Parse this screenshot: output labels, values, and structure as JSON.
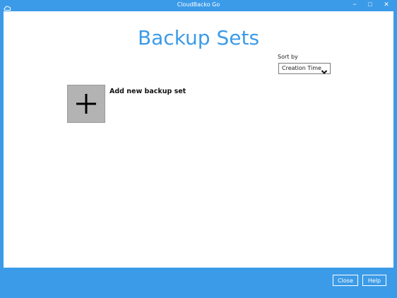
{
  "window": {
    "title": "CloudBacko Go",
    "controls": {
      "minimize": "−",
      "maximize": "□",
      "close": "✕"
    }
  },
  "main": {
    "page_title": "Backup Sets",
    "sort": {
      "label": "Sort by",
      "selected": "Creation Time"
    },
    "add_tile": {
      "label": "Add new backup set",
      "icon": "plus-icon"
    }
  },
  "footer": {
    "close_label": "Close",
    "help_label": "Help"
  },
  "colors": {
    "accent": "#3c9be8",
    "tile": "#b3b3b3"
  }
}
